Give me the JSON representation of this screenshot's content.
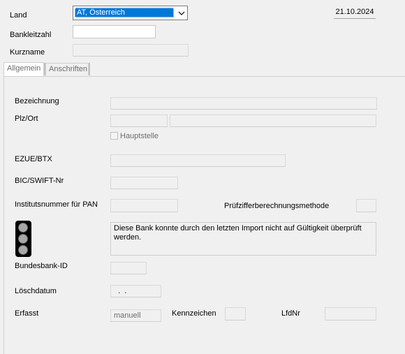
{
  "header": {
    "land_label": "Land",
    "land_value": "AT, Österreich",
    "date": "21.10.2024",
    "bankleitzahl_label": "Bankleitzahl",
    "bankleitzahl_value": "",
    "kurzname_label": "Kurzname",
    "kurzname_value": ""
  },
  "tabs": [
    {
      "label": "Allgemein",
      "active": true
    },
    {
      "label": "Anschriften",
      "active": false
    }
  ],
  "form": {
    "bezeichnung_label": "Bezeichnung",
    "bezeichnung_value": "",
    "plzort_label": "Plz/Ort",
    "plz_value": "",
    "ort_value": "",
    "hauptstelle_label": "Hauptstelle",
    "hauptstelle_checked": false,
    "ezue_label": "EZUE/BTX",
    "ezue_value": "",
    "bic_label": "BIC/SWIFT-Nr",
    "bic_value": "",
    "institut_label": "Institutsnummer für PAN",
    "institut_value": "",
    "pruef_label": "Prüfzifferberechnungsmethode",
    "pruef_value": "",
    "status_message": "Diese Bank konnte durch den letzten Import nicht auf Gültigkeit überprüft werden.",
    "status_icon": "traffic-light-icon",
    "bundesbank_label": "Bundesbank-ID",
    "bundesbank_value": "",
    "loeschdatum_label": "Löschdatum",
    "loeschdatum_value": "  .  .",
    "erfasst_label": "Erfasst",
    "erfasst_value": "manuell",
    "kennzeichen_label": "Kennzeichen",
    "kennzeichen_value": "",
    "lfdnr_label": "LfdNr",
    "lfdnr_value": ""
  },
  "colors": {
    "selection": "#0078d7",
    "background": "#f0f0f0"
  }
}
